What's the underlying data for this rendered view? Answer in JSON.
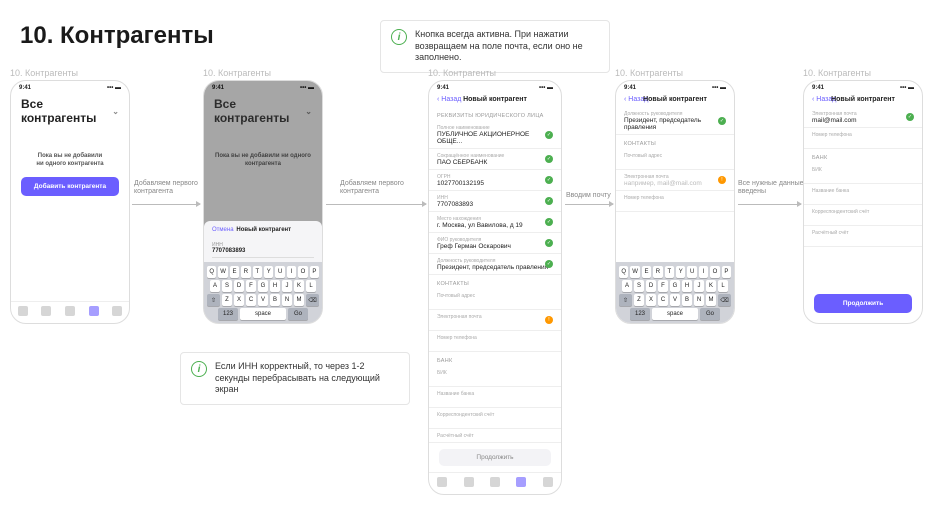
{
  "page_title": "10. Контрагенты",
  "info_top": "Кнопка всегда активна. При нажатии возвращаем на поле почта, если оно не заполнено.",
  "info_bottom": "Если ИНН корректный, то через 1-2 секунды перебрасывать на следующий экран",
  "section_labels": [
    "10. Контрагенты",
    "10. Контрагенты",
    "10. Контрагенты",
    "10. Контрагенты",
    "10. Контрагенты"
  ],
  "status_time": "9:41",
  "screen1": {
    "header": "Все контрагенты",
    "empty": "Пока вы не добавили\nни одного контрагента",
    "button": "Добавить контрагента"
  },
  "screen2": {
    "header": "Все контрагенты",
    "empty": "Пока вы не добавили\nни одного контрагента",
    "sheet_cancel": "Отмена",
    "sheet_title": "Новый контрагент",
    "sheet_label": "ИНН",
    "sheet_value": "7707083893"
  },
  "screen3": {
    "back": "Назад",
    "title": "Новый контрагент",
    "rows": [
      {
        "lbl": "Реквизиты юридического лица",
        "type": "section"
      },
      {
        "lbl": "Полное наименование",
        "val": "ПУБЛИЧНОЕ АКЦИОНЕРНОЕ ОБЩЕ...",
        "check": true
      },
      {
        "lbl": "Сокращённое наименование",
        "val": "ПАО СБЕРБАНК",
        "check": true
      },
      {
        "lbl": "ОГРН",
        "val": "1027700132195",
        "check": true
      },
      {
        "lbl": "ИНН",
        "val": "7707083893",
        "check": true
      },
      {
        "lbl": "Место нахождения",
        "val": "г. Москва, ул Вавилова, д 19",
        "check": true
      },
      {
        "lbl": "ФИО руководителя",
        "val": "Греф Герман Оскарович",
        "check": true
      },
      {
        "lbl": "Должность руководителя",
        "val": "Президент, председатель правления",
        "check": true
      },
      {
        "lbl": "КОНТАКТЫ",
        "type": "section"
      },
      {
        "lbl": "Почтовый адрес",
        "ph": ""
      },
      {
        "lbl": "Электронная почта",
        "ph": "",
        "warn": true
      },
      {
        "lbl": "Номер телефона",
        "ph": ""
      },
      {
        "lbl": "БАНК",
        "type": "section"
      },
      {
        "lbl": "БИК",
        "ph": ""
      },
      {
        "lbl": "Название банка",
        "ph": ""
      },
      {
        "lbl": "Корреспондентский счёт",
        "ph": ""
      },
      {
        "lbl": "Расчётный счёт",
        "ph": ""
      }
    ],
    "button": "Продолжить"
  },
  "screen4": {
    "back": "Назад",
    "title": "Новый контрагент",
    "top_lbl": "Должность руководителя",
    "top_val": "Президент, председатель правления",
    "section": "КОНТАКТЫ",
    "rows": [
      {
        "lbl": "Почтовый адрес",
        "ph": ""
      },
      {
        "lbl": "Электронная почта",
        "ph": "например, mail@mail.com",
        "warn": true
      },
      {
        "lbl": "Номер телефона",
        "ph": ""
      }
    ]
  },
  "screen5": {
    "back": "Назад",
    "title": "Новый контрагент",
    "rows": [
      {
        "lbl": "Электронная почта",
        "val": "mail@mail.com",
        "check": true
      },
      {
        "lbl": "Номер телефона",
        "ph": ""
      },
      {
        "lbl": "БАНК",
        "type": "section"
      },
      {
        "lbl": "БИК",
        "ph": ""
      },
      {
        "lbl": "Название банка",
        "ph": ""
      },
      {
        "lbl": "Корреспондентский счёт",
        "ph": ""
      },
      {
        "lbl": "Расчётный счёт",
        "ph": ""
      }
    ],
    "button": "Продолжить"
  },
  "arrows": {
    "a1": "Добавляем первого\nконтрагента",
    "a2": "Добавляем первого\nконтрагента",
    "a3": "Вводим почту",
    "a4": "Все нужные данные\nвведены"
  },
  "kb": {
    "r1": [
      "Q",
      "W",
      "E",
      "R",
      "T",
      "Y",
      "U",
      "I",
      "O",
      "P"
    ],
    "r2": [
      "A",
      "S",
      "D",
      "F",
      "G",
      "H",
      "J",
      "K",
      "L"
    ],
    "r3": [
      "Z",
      "X",
      "C",
      "V",
      "B",
      "N",
      "M"
    ],
    "num": "123",
    "space": "space",
    "go": "Go"
  }
}
